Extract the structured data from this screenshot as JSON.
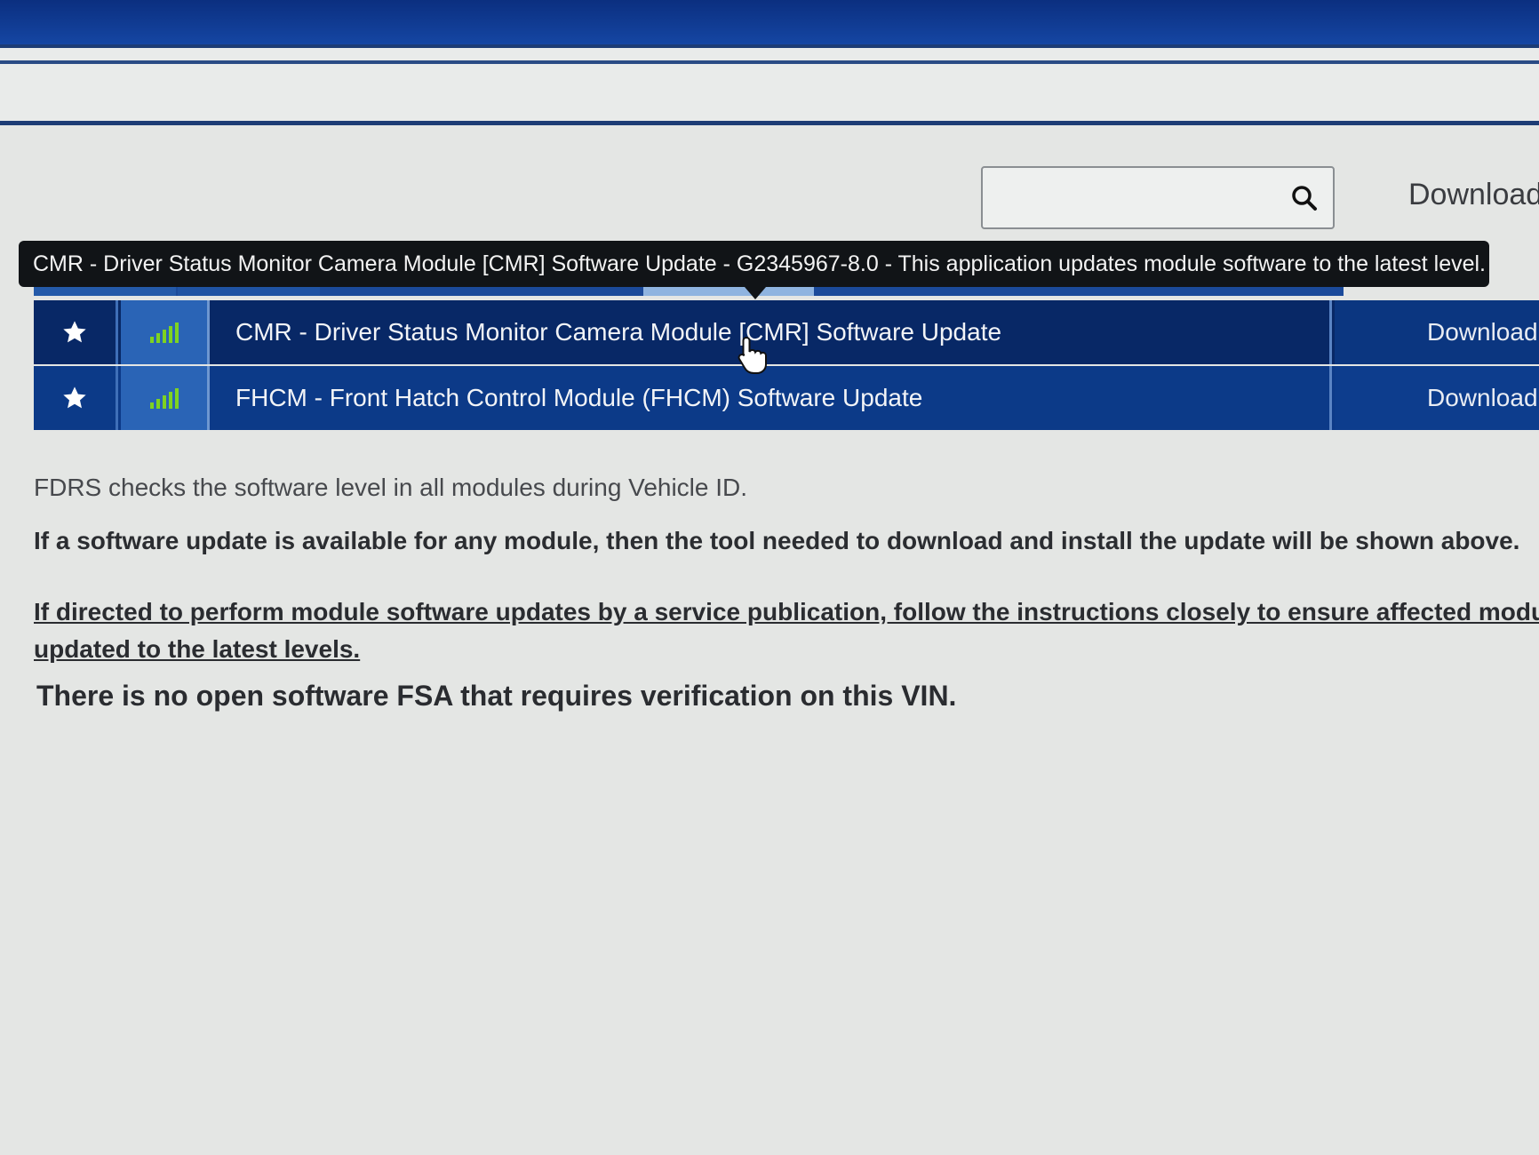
{
  "header": {
    "download_label": "Download"
  },
  "search": {
    "placeholder": "",
    "value": ""
  },
  "tooltip": {
    "text": "CMR - Driver Status Monitor Camera Module [CMR] Software Update - G2345967-8.0 - This application updates module software to the latest level."
  },
  "colors": {
    "accent": "#0c3a88",
    "active_row": "#082866",
    "signal_green": "#7ed321"
  },
  "rows": [
    {
      "title": "CMR - Driver Status Monitor Camera Module [CMR] Software Update",
      "action": "Download",
      "star_icon": "star-icon",
      "signal_icon": "signal-bars-icon",
      "active": true
    },
    {
      "title": "FHCM - Front Hatch Control Module (FHCM) Software Update",
      "action": "Download",
      "star_icon": "star-icon",
      "signal_icon": "signal-bars-icon",
      "active": false
    }
  ],
  "info": {
    "line1": "FDRS checks the software level in all modules during Vehicle ID.",
    "line2": "If a software update is available for any module, then the tool needed to download and install the update will be shown above.",
    "link_line1": "If directed to perform module software updates by a service publication, follow the instructions closely to ensure affected modu",
    "link_line2": "updated to the latest levels.",
    "fsa_notice": "There is no open software FSA that requires verification on this VIN."
  }
}
